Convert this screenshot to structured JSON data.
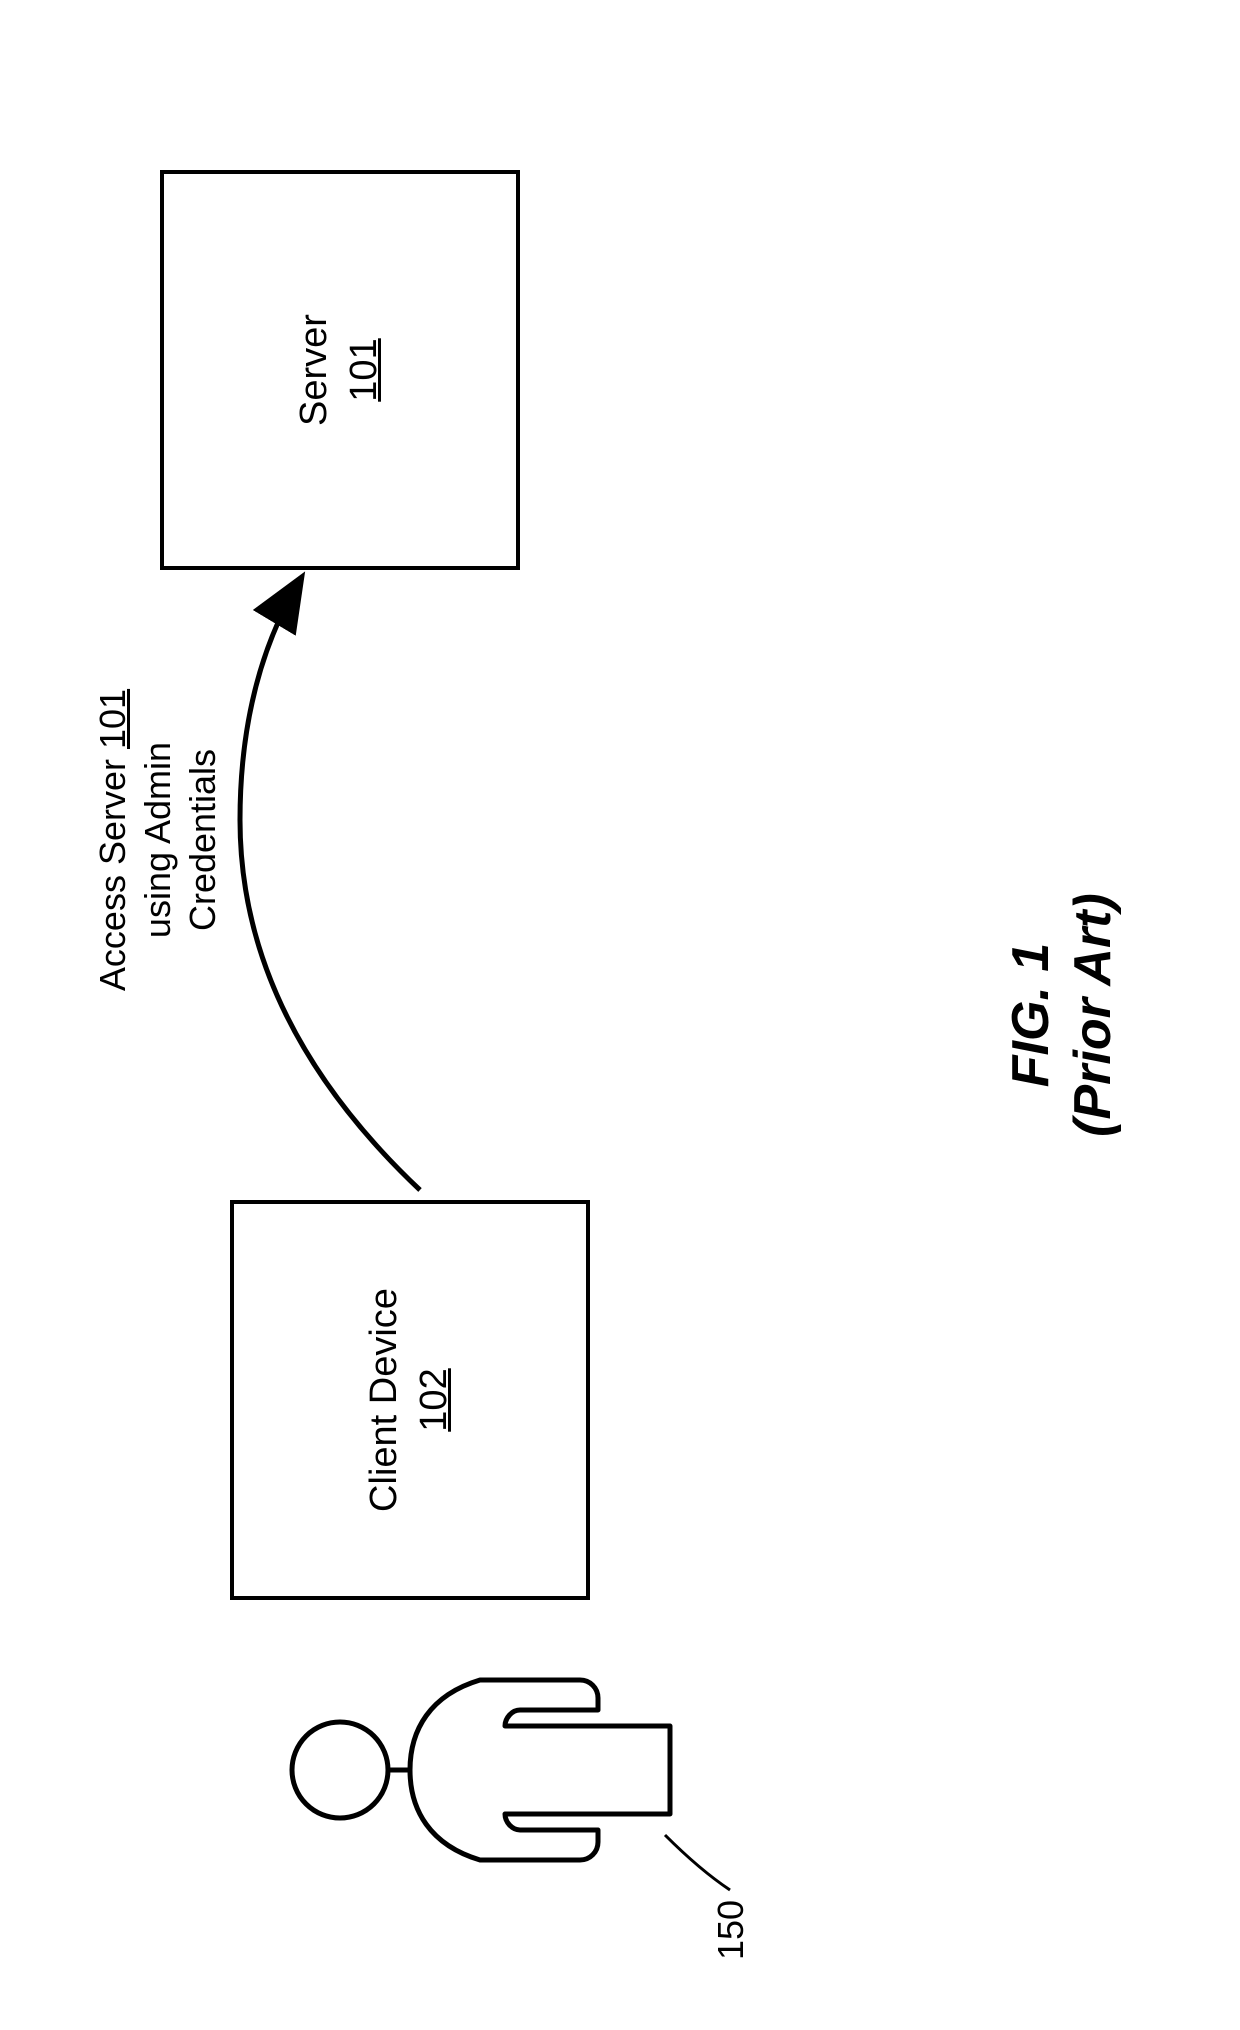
{
  "diagram": {
    "client": {
      "label": "Client Device",
      "ref": "102"
    },
    "server": {
      "label": "Server",
      "ref": "101"
    },
    "arrow": {
      "line1_pre": "Access Server ",
      "line1_ref": "101",
      "line2": "using Admin",
      "line3": "Credentials"
    },
    "person_ref": "150",
    "caption": {
      "line1": "FIG. 1",
      "line2": "(Prior Art)"
    }
  }
}
